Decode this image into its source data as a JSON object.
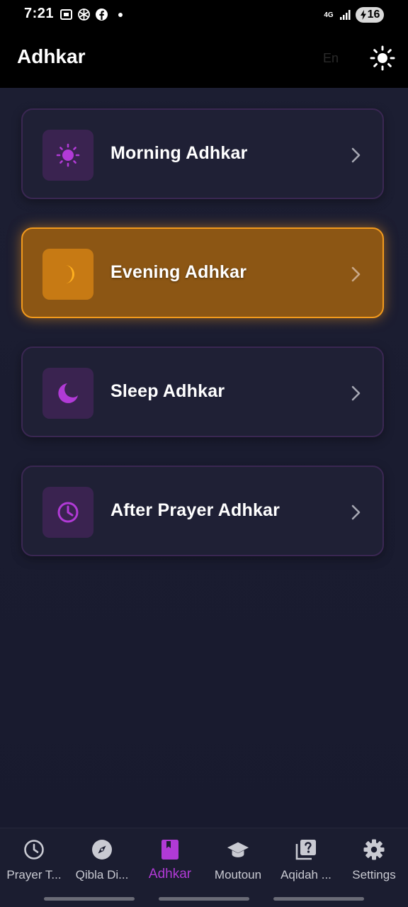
{
  "status_bar": {
    "time": "7:21",
    "network": "4G",
    "battery": "16",
    "icons": [
      "screenshot-icon",
      "openai-icon",
      "facebook-icon",
      "notification-dot-icon",
      "signal-icon",
      "charging-icon"
    ]
  },
  "app_bar": {
    "title": "Adhkar",
    "language_label": "En",
    "theme_icon": "sun-icon"
  },
  "colors": {
    "background": "#1a1c30",
    "card_background": "#1f2035",
    "card_border": "#3a2752",
    "accent_purple": "#b13ad6",
    "active_orange": "#f29a1d",
    "active_card_fill": "#8c5614"
  },
  "adhkar_list": [
    {
      "label": "Morning Adhkar",
      "icon": "sun-icon",
      "active": false
    },
    {
      "label": "Evening Adhkar",
      "icon": "crescent-moon-icon",
      "active": true
    },
    {
      "label": "Sleep Adhkar",
      "icon": "moon-icon",
      "active": false
    },
    {
      "label": "After Prayer Adhkar",
      "icon": "clock-icon",
      "active": false
    }
  ],
  "bottom_nav": {
    "selected": "Adhkar",
    "items": [
      {
        "label": "Prayer T...",
        "icon": "clock-icon"
      },
      {
        "label": "Qibla Di...",
        "icon": "compass-icon"
      },
      {
        "label": "Adhkar",
        "icon": "book-icon"
      },
      {
        "label": "Moutoun",
        "icon": "graduation-cap-icon"
      },
      {
        "label": "Aqidah ...",
        "icon": "quiz-icon"
      },
      {
        "label": "Settings",
        "icon": "gear-icon"
      }
    ]
  }
}
